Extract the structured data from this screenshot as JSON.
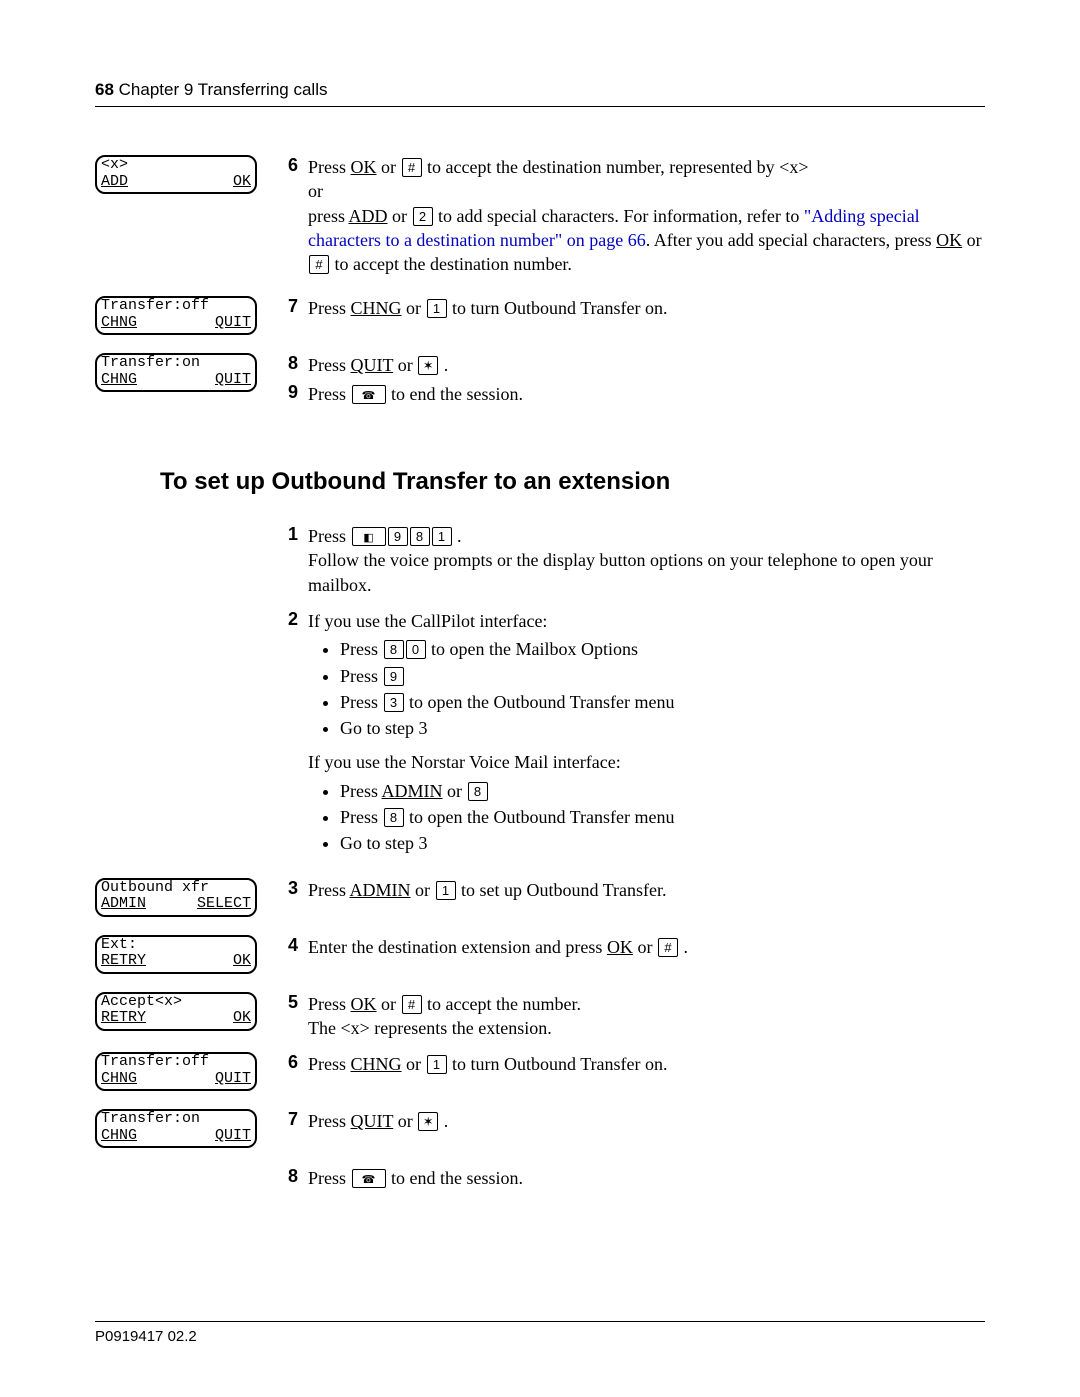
{
  "header": {
    "page": "68",
    "chapter": "Chapter 9  Transferring calls"
  },
  "displays": {
    "d1_line1_left": "<x>",
    "d1_line2_left": "ADD",
    "d1_line2_right": "OK",
    "d2_line1_left": "Transfer:off",
    "d2_line2_left": "CHNG",
    "d2_line2_right": "QUIT",
    "d3_line1_left": "Transfer:on",
    "d3_line2_left": "CHNG",
    "d3_line2_right": "QUIT",
    "d4_line1_left": "Outbound xfr",
    "d4_line2_left": "ADMIN",
    "d4_line2_right": "SELECT",
    "d5_line1_left": "Ext:",
    "d5_line2_left": "RETRY",
    "d5_line2_right": "OK",
    "d6_line1_left": "Accept<x>",
    "d6_line2_left": "RETRY",
    "d6_line2_right": "OK",
    "d7_line1_left": "Transfer:off",
    "d7_line2_left": "CHNG",
    "d7_line2_right": "QUIT",
    "d8_line1_left": "Transfer:on",
    "d8_line2_left": "CHNG",
    "d8_line2_right": "QUIT"
  },
  "steps_a": {
    "n6": "6",
    "s6a": "Press ",
    "s6_ok": "OK",
    "s6b": " or ",
    "s6_hash": "#",
    "s6c": " to accept the destination number, represented by <x>",
    "s6_or": "or",
    "s6d": "press ",
    "s6_add": "ADD",
    "s6e": " or ",
    "s6_2": "2",
    "s6f": " to add special characters. For information, refer to ",
    "s6_link": "\"Adding special characters to a destination number\" on page 66",
    "s6g": ". After you add special characters, press ",
    "s6_ok2": "OK",
    "s6h": " or ",
    "s6_hash2": "#",
    "s6i": " to accept the destination number.",
    "n7": "7",
    "s7a": "Press ",
    "s7_chng": "CHNG",
    "s7b": " or ",
    "s7_1": "1",
    "s7c": " to turn Outbound Transfer on.",
    "n8": "8",
    "s8a": "Press ",
    "s8_quit": "QUIT",
    "s8b": " or ",
    "s8_star": "✶",
    "s8c": " .",
    "n9": "9",
    "s9a": "Press ",
    "s9b": " to end the session."
  },
  "section_title": "To set up Outbound Transfer to an extension",
  "steps_b": {
    "n1": "1",
    "s1a": "Press ",
    "s1_k9": "9",
    "s1_k8": "8",
    "s1_k1": "1",
    "s1b": " .",
    "s1c": "Follow the voice prompts or the display button options on your telephone to open your mailbox.",
    "n2": "2",
    "s2a": "If you use the CallPilot interface:",
    "b2_1a": "Press ",
    "b2_1_k8": "8",
    "b2_1_k0": "0",
    "b2_1b": " to open the Mailbox Options",
    "b2_2a": "Press ",
    "b2_2_k9": "9",
    "b2_3a": "Press ",
    "b2_3_k3": "3",
    "b2_3b": " to open the Outbound Transfer menu",
    "b2_4": "Go to step 3",
    "s2b": "If you use the Norstar Voice Mail interface:",
    "b2b_1a": "Press ",
    "b2b_1_admin": "ADMIN",
    "b2b_1b": " or ",
    "b2b_1_k8": "8",
    "b2b_2a": "Press ",
    "b2b_2_k8": "8",
    "b2b_2b": " to open the Outbound Transfer menu",
    "b2b_3": "Go to step 3",
    "n3": "3",
    "s3a": "Press ",
    "s3_admin": "ADMIN",
    "s3b": " or ",
    "s3_k1": "1",
    "s3c": " to set up Outbound Transfer.",
    "n4": "4",
    "s4a": "Enter the destination extension and press ",
    "s4_ok": "OK",
    "s4b": " or ",
    "s4_hash": "#",
    "s4c": " .",
    "n5": "5",
    "s5a": "Press ",
    "s5_ok": "OK",
    "s5b": " or ",
    "s5_hash": "#",
    "s5c": " to accept the number.",
    "s5d": "The <x> represents the extension.",
    "n6": "6",
    "s6a": "Press ",
    "s6_chng": "CHNG",
    "s6b": " or ",
    "s6_k1": "1",
    "s6c": " to turn Outbound Transfer on.",
    "n7": "7",
    "s7a": "Press ",
    "s7_quit": "QUIT",
    "s7b": " or ",
    "s7_star": "✶",
    "s7c": " .",
    "n8": "8",
    "s8a": "Press ",
    "s8b": " to end the session."
  },
  "footer": "P0919417 02.2"
}
